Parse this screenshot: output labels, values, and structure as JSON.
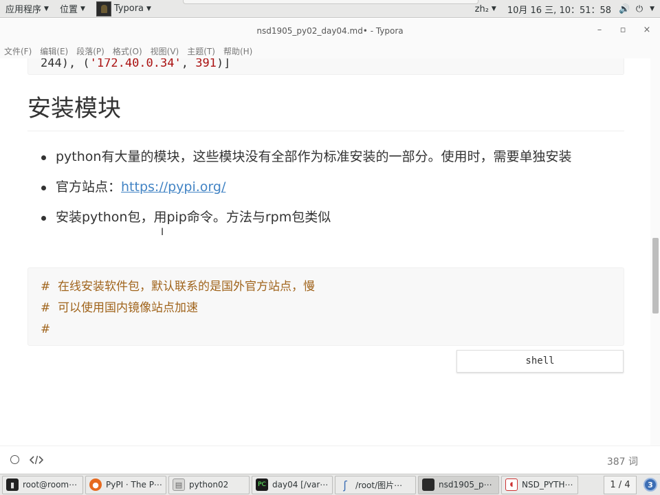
{
  "topbar": {
    "applications": "应用程序",
    "places": "位置",
    "active_app": "Typora",
    "input_method": "zh₂",
    "clock": "10月 16 三, 10：51：58"
  },
  "window": {
    "title": "nsd1905_py02_day04.md• - Typora",
    "minimize": "–",
    "maximize": "▫",
    "close": "×"
  },
  "menu": [
    "文件(F)",
    "编辑(E)",
    "段落(P)",
    "格式(O)",
    "视图(V)",
    "主题(T)",
    "帮助(H)"
  ],
  "editor": {
    "code_top_prefix": "244), (",
    "code_top_string": "'172.40.0.34'",
    "code_top_mid": ", ",
    "code_top_num": "391",
    "code_top_suffix": ")]",
    "heading": "安装模块",
    "bullet1": "python有大量的模块，这些模块没有全部作为标准安装的一部分。使用时，需要单独安装",
    "bullet2_prefix": "官方站点：",
    "bullet2_link": "https://pypi.org/",
    "bullet3": "安装python包，用pip命令。方法与rpm包类似",
    "code_lines": [
      "#  在线安装软件包，默认联系的是国外官方站点，慢",
      "#  可以使用国内镜像站点加速",
      "#"
    ],
    "code_lang": "shell"
  },
  "footer": {
    "word_count": "387 词"
  },
  "taskbar": {
    "tasks": [
      {
        "label": "root@room⋯",
        "icon": "terminal-icon"
      },
      {
        "label": "PyPI · The P⋯",
        "icon": "firefox-icon"
      },
      {
        "label": "python02",
        "icon": "file-manager-icon"
      },
      {
        "label": "day04 [/var⋯",
        "icon": "pycharm-icon"
      },
      {
        "label": "/root/图片⋯",
        "icon": "image-viewer-icon"
      },
      {
        "label": "nsd1905_p⋯",
        "icon": "typora-icon"
      },
      {
        "label": "NSD_PYTH⋯",
        "icon": "document-icon"
      }
    ],
    "pager": "1 / 4",
    "notifications": "3"
  }
}
